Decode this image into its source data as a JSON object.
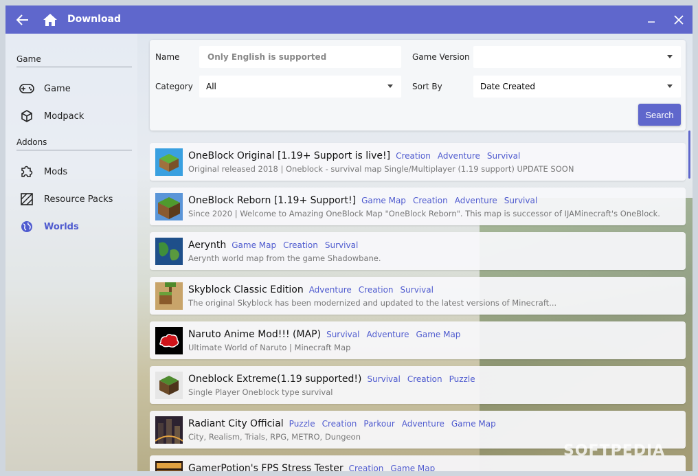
{
  "titlebar": {
    "title": "Download"
  },
  "sidebar": {
    "sections": [
      {
        "label": "Game",
        "items": [
          {
            "label": "Game",
            "icon": "gamepad-icon"
          },
          {
            "label": "Modpack",
            "icon": "cube-icon"
          }
        ]
      },
      {
        "label": "Addons",
        "items": [
          {
            "label": "Mods",
            "icon": "puzzle-icon"
          },
          {
            "label": "Resource Packs",
            "icon": "texture-icon"
          },
          {
            "label": "Worlds",
            "icon": "globe-icon",
            "active": true
          }
        ]
      }
    ]
  },
  "search": {
    "name_label": "Name",
    "name_placeholder": "Only English is supported",
    "name_value": "",
    "game_version_label": "Game Version",
    "game_version_value": "",
    "category_label": "Category",
    "category_value": "All",
    "sort_by_label": "Sort By",
    "sort_by_value": "Date Created",
    "search_label": "Search"
  },
  "results": [
    {
      "title": "OneBlock Original [1.19+ Support is live!]",
      "tags": [
        "Creation",
        "Adventure",
        "Survival"
      ],
      "desc": "Original released 2018 | Oneblock - survival map Single/Multiplayer (1.19 support) UPDATE SOON",
      "thumb": "oneblock"
    },
    {
      "title": "OneBlock Reborn [1.19+ Support!]",
      "tags": [
        "Game Map",
        "Creation",
        "Adventure",
        "Survival"
      ],
      "desc": "Since 2020 | Welcome to Amazing OneBlock Map \"OneBlock Reborn\". This map is successor of IJAMinecraft's OneBlock.",
      "thumb": "oneblock2"
    },
    {
      "title": "Aerynth",
      "tags": [
        "Game Map",
        "Creation",
        "Survival"
      ],
      "desc": "Aerynth world map from the game Shadowbane.",
      "thumb": "map"
    },
    {
      "title": "Skyblock Classic Edition",
      "tags": [
        "Adventure",
        "Creation",
        "Survival"
      ],
      "desc": "The original Skyblock has been modernized and updated to the latest versions of Minecraft...",
      "thumb": "sky"
    },
    {
      "title": "Naruto Anime Mod!!! (MAP)",
      "tags": [
        "Survival",
        "Adventure",
        "Game Map"
      ],
      "desc": "Ultimate World of Naruto | Minecraft Map",
      "thumb": "naruto"
    },
    {
      "title": "Oneblock Extreme(1.19 supported!)",
      "tags": [
        "Survival",
        "Creation",
        "Puzzle"
      ],
      "desc": "Single Player Oneblock type survival",
      "thumb": "grass"
    },
    {
      "title": "Radiant City Official",
      "tags": [
        "Puzzle",
        "Creation",
        "Parkour",
        "Adventure",
        "Game Map"
      ],
      "desc": "City, Realism, Trials, RPG, METRO, Dungeon",
      "thumb": "city"
    },
    {
      "title": "GamerPotion's FPS Stress Tester",
      "tags": [
        "Creation",
        "Game Map"
      ],
      "desc": "",
      "thumb": "fps"
    }
  ],
  "colors": {
    "accent": "#5f67cc",
    "tag": "#4f5bcf"
  }
}
